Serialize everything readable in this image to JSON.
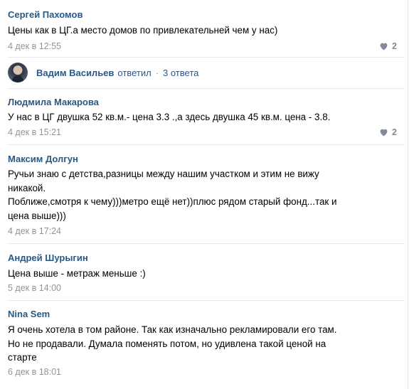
{
  "comments": [
    {
      "author": "Сергей Пахомов",
      "text": "Цены как в ЦГ.а место домов по привлекательней чем у нас)",
      "date": "4 дек в 12:55",
      "likes": "2"
    },
    {
      "author": "Людмила Макарова",
      "text": "У нас в ЦГ двушка 52 кв.м.- цена 3.3 .,а здесь двушка 45 кв.м. цена - 3.8.",
      "date": "4 дек в 15:21",
      "likes": "2"
    },
    {
      "author": "Максим Долгун",
      "text": "Ручьи знаю с детства,разницы между нашим участком и этим не вижу\nникакой.\nПоближе,смотря к чему)))метро ещё нет))плюс рядом старый фонд...так и\nцена выше)))",
      "date": "4 дек в 17:24"
    },
    {
      "author": "Андрей Шурыгин",
      "text": "Цена выше - метраж меньше :)",
      "date": "5 дек в 14:00"
    },
    {
      "author": "Nina Sem",
      "text": "Я очень хотела в том районе. Так как изначально рекламировали его там.\nНо не продавали. Думала поменять потом, но удивлена такой ценой на\nстарте",
      "date": "6 дек в 18:01"
    }
  ],
  "replied": {
    "author": "Вадим Васильев",
    "verb": "ответил",
    "separator": "·",
    "replies": "3 ответа"
  },
  "colors": {
    "link": "#2a5885",
    "meta": "#939393",
    "like_icon": "#828a99",
    "divider": "#e7e8ec"
  }
}
